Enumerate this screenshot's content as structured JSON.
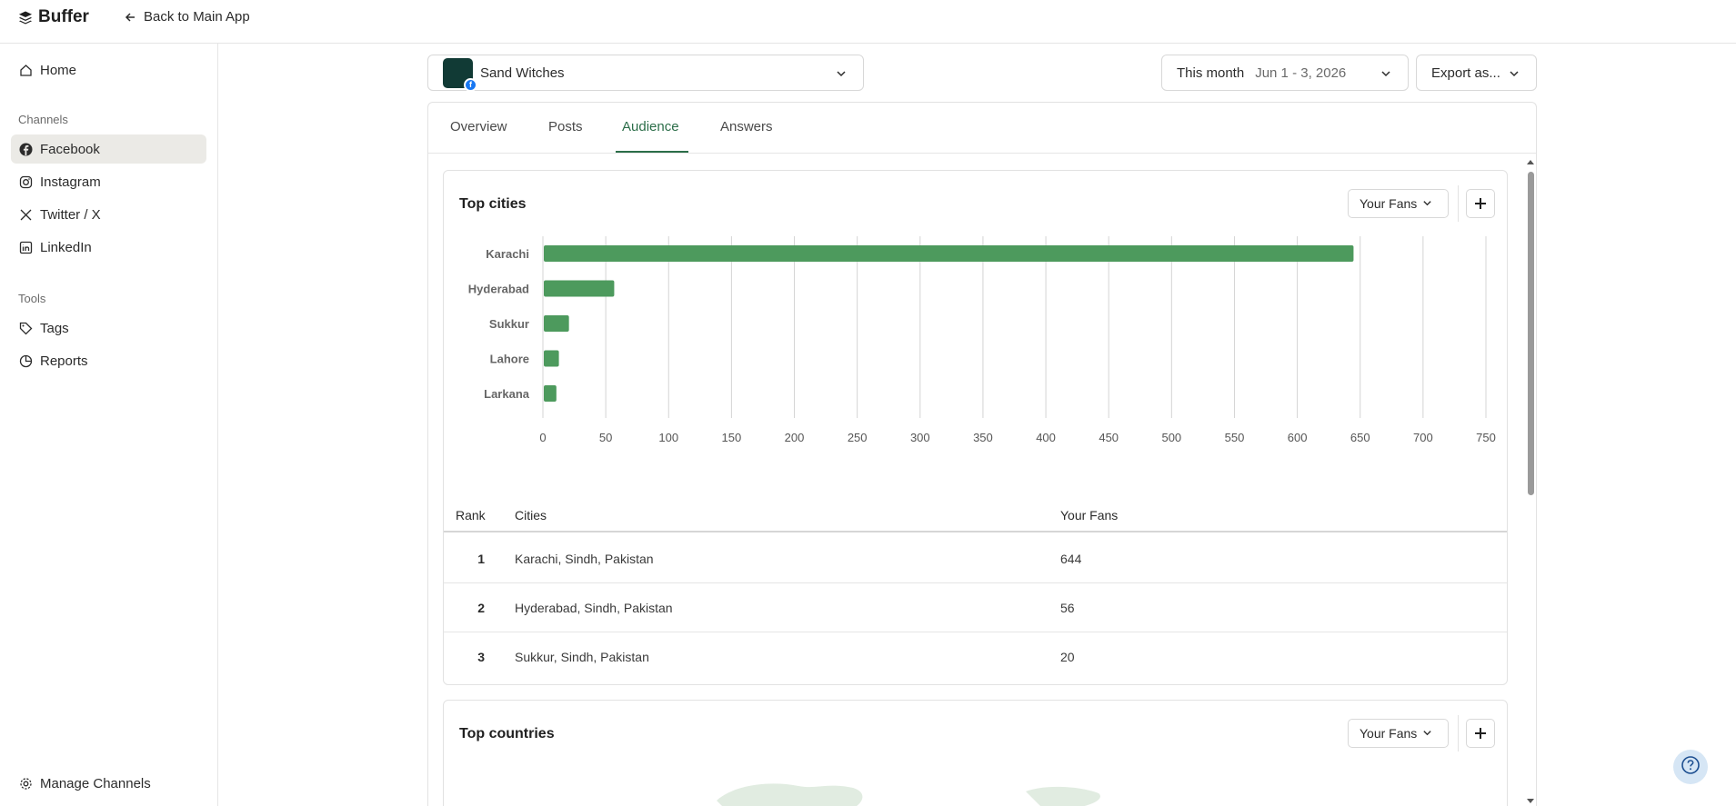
{
  "app": {
    "logo_text": "Buffer",
    "back_label": "Back to Main App"
  },
  "sidebar": {
    "home": "Home",
    "channels_heading": "Channels",
    "channels": [
      {
        "label": "Facebook",
        "icon": "facebook-icon"
      },
      {
        "label": "Instagram",
        "icon": "instagram-icon"
      },
      {
        "label": "Twitter / X",
        "icon": "x-icon"
      },
      {
        "label": "LinkedIn",
        "icon": "linkedin-icon"
      }
    ],
    "tools_heading": "Tools",
    "tools": [
      {
        "label": "Tags",
        "icon": "tag-icon"
      },
      {
        "label": "Reports",
        "icon": "reports-icon"
      }
    ],
    "manage": "Manage Channels"
  },
  "header": {
    "channel_name": "Sand Witches",
    "period_label": "This month",
    "date_range": "Jun 1 - 3, 2026",
    "export_label": "Export as..."
  },
  "tabs": [
    {
      "label": "Overview"
    },
    {
      "label": "Posts"
    },
    {
      "label": "Audience",
      "active": true
    },
    {
      "label": "Answers"
    }
  ],
  "cities_card": {
    "title": "Top cities",
    "metric_select": "Your Fans",
    "table": {
      "columns": [
        "Rank",
        "Cities",
        "Your Fans"
      ],
      "rows": [
        {
          "rank": "1",
          "city": "Karachi, Sindh, Pakistan",
          "fans": "644"
        },
        {
          "rank": "2",
          "city": "Hyderabad, Sindh, Pakistan",
          "fans": "56"
        },
        {
          "rank": "3",
          "city": "Sukkur, Sindh, Pakistan",
          "fans": "20"
        }
      ]
    }
  },
  "countries_card": {
    "title": "Top countries",
    "metric_select": "Your Fans"
  },
  "colors": {
    "accent": "#2c6e49",
    "bar": "#4d9a5d",
    "grid": "#d4d4d4"
  },
  "chart_data": {
    "type": "bar",
    "orientation": "horizontal",
    "categories": [
      "Karachi",
      "Hyderabad",
      "Sukkur",
      "Lahore",
      "Larkana"
    ],
    "values": [
      644,
      56,
      20,
      12,
      10
    ],
    "xlim": [
      0,
      750
    ],
    "xticks": [
      0,
      50,
      100,
      150,
      200,
      250,
      300,
      350,
      400,
      450,
      500,
      550,
      600,
      650,
      700,
      750
    ],
    "grid": true
  }
}
